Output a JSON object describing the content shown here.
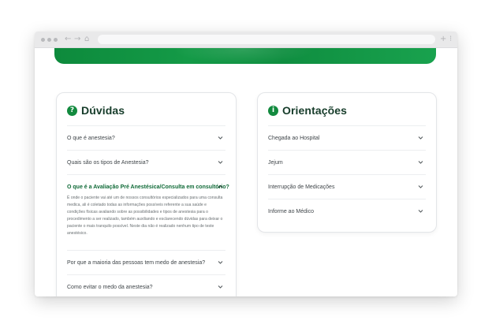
{
  "browser": {
    "nav_icons": [
      "back-arrow-icon",
      "forward-arrow-icon",
      "home-icon"
    ],
    "nav_glyphs": {
      "back": "←",
      "forward": "→",
      "home": "⌂"
    },
    "new_tab_glyph": "+",
    "menu_glyph": "⁝"
  },
  "colors": {
    "brand_green": "#128a3e",
    "title_dark": "#163c2a",
    "expanded_question": "#0f6a37"
  },
  "duvidas": {
    "icon_glyph": "?",
    "icon": "question-circle-icon",
    "title": "Dúvidas",
    "items": [
      {
        "question": "O que é anestesia?",
        "expanded": false
      },
      {
        "question": "Quais são os tipos de Anestesia?",
        "expanded": false
      },
      {
        "question": "O que é a Avaliação Pré Anestésica/Consulta em consultório?",
        "expanded": true,
        "answer": "É onde o paciente vai até um de nossos consultórios especializados para uma consulta medica, ali é coletado todas as informações possíveis referente a sua saúde e condições físicas avaliando sobre as possibilidades e tipos de anestesia para o procedimento a ser realizado, também auxiliando e esclarecendo dúvidas para deixar o paciente o mais tranquilo possível. Neste dia não é realizado nenhum tipo de teste anestésico."
      },
      {
        "question": "Por que a maioria das pessoas tem medo de anestesia?",
        "expanded": false
      },
      {
        "question": "Como evitar o medo da anestesia?",
        "expanded": false
      }
    ]
  },
  "orientacoes": {
    "icon_glyph": "i",
    "icon": "info-circle-icon",
    "title": "Orientações",
    "items": [
      {
        "label": "Chegada ao Hospital"
      },
      {
        "label": "Jejum"
      },
      {
        "label": "Interrupção de Medicações"
      },
      {
        "label": "Informe ao Médico"
      }
    ]
  }
}
